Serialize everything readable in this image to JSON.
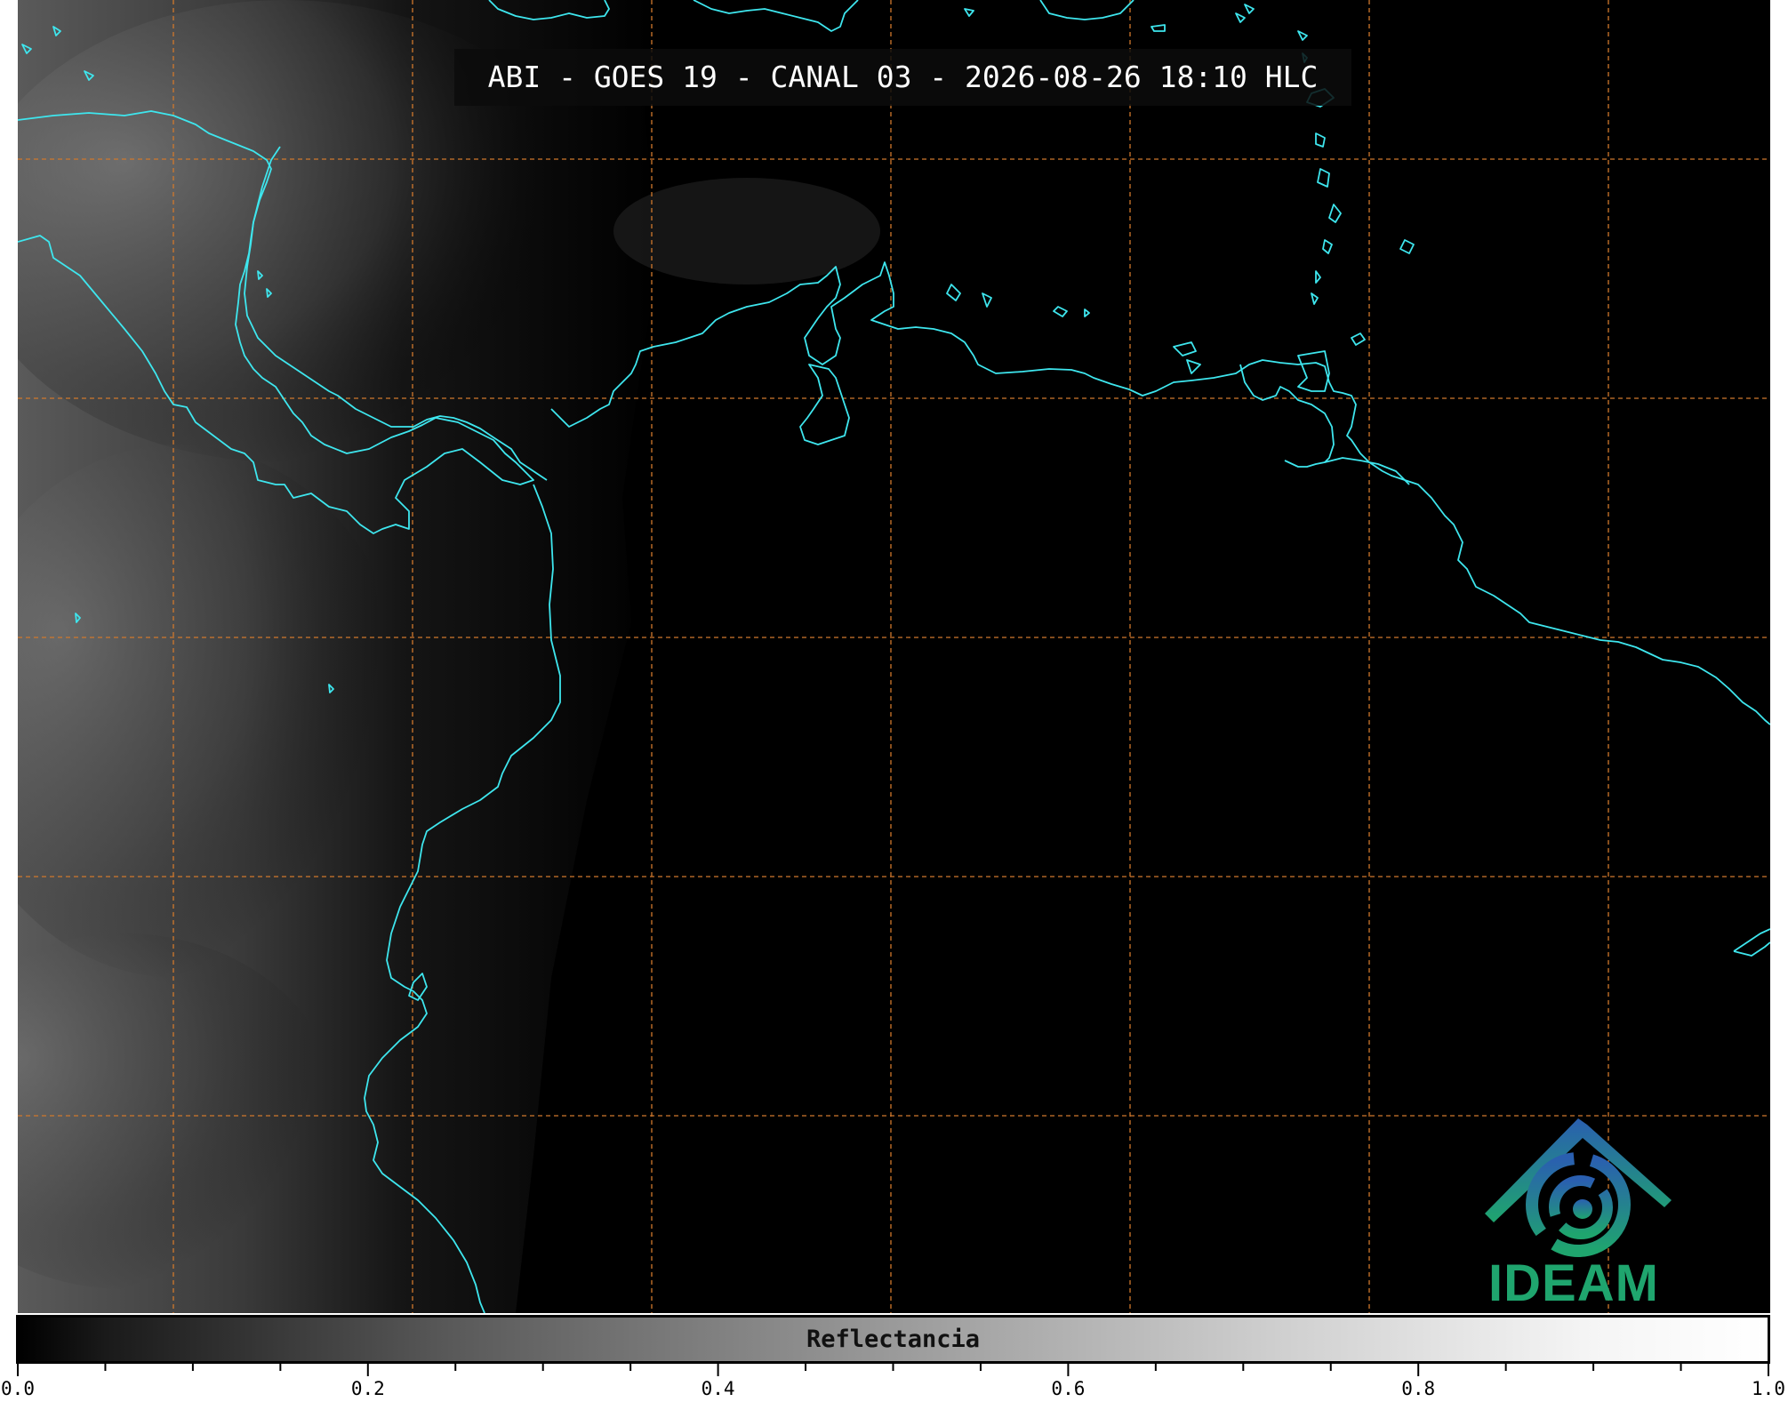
{
  "title": "ABI - GOES 19 - CANAL 03 - 2026-08-26 18:10 HLC",
  "colorbar": {
    "label": "Reflectancia",
    "range": [
      0.0,
      1.0
    ],
    "major_ticks": [
      0.0,
      0.2,
      0.4,
      0.6,
      0.8,
      1.0
    ],
    "tick_labels": [
      "0.0",
      "0.2",
      "0.4",
      "0.6",
      "0.8",
      "1.0"
    ],
    "minor_tick_step": 0.05
  },
  "logo": {
    "text": "IDEAM",
    "icon": "ideam-swirl-logo-icon",
    "colors": [
      "#2a78b5",
      "#1fa56e"
    ]
  },
  "map": {
    "graticule": "dashed orange lines, 7 columns x 6 rows",
    "coastline_color": "#3ee6ee",
    "graticule_color": "#d0782c",
    "background": "#000000"
  }
}
